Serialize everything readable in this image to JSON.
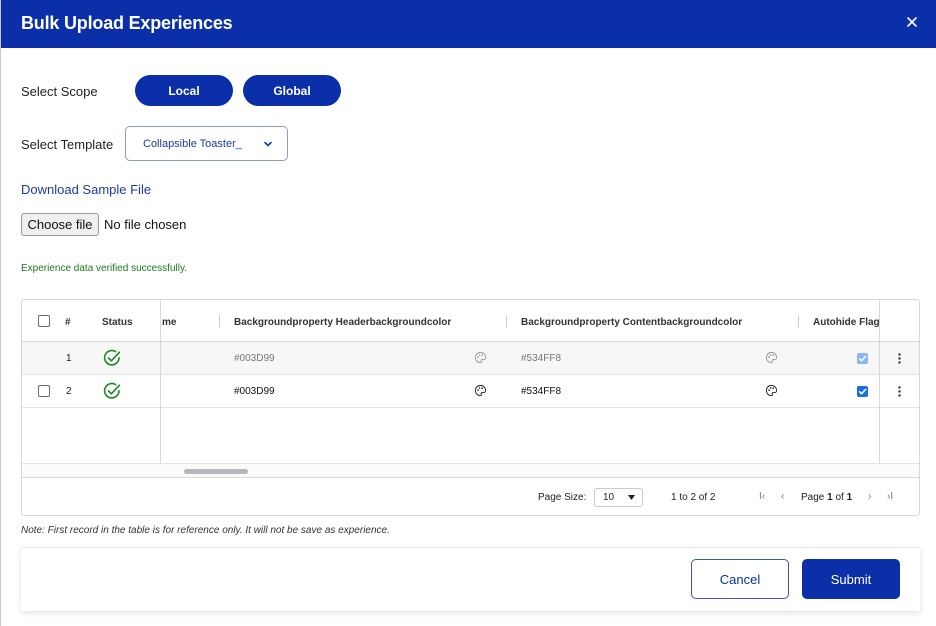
{
  "dialog": {
    "title": "Bulk Upload Experiences"
  },
  "scope": {
    "label": "Select Scope",
    "options": [
      "Local",
      "Global"
    ]
  },
  "template": {
    "label": "Select Template",
    "selected": "Collapsible Toaster_"
  },
  "download_link": "Download Sample File",
  "file_input": {
    "button": "Choose file",
    "status": "No file chosen"
  },
  "verification_message": "Experience data verified successfully.",
  "table": {
    "columns": [
      "#",
      "Status",
      "me",
      "Backgroundproperty Headerbackgroundcolor",
      "Backgroundproperty Contentbackgroundcolor",
      "Autohide Flag"
    ],
    "rows": [
      {
        "num": "1",
        "header_bg": "#003D99",
        "content_bg": "#534FF8",
        "autohide": true,
        "reference": true
      },
      {
        "num": "2",
        "header_bg": "#003D99",
        "content_bg": "#534FF8",
        "autohide": true,
        "reference": false
      }
    ]
  },
  "pagination": {
    "page_size_label": "Page Size:",
    "page_size": "10",
    "range": "1 to 2 of 2",
    "page_prefix": "Page",
    "current_page": "1",
    "page_of": "of",
    "total_pages": "1"
  },
  "note": "Note: First record in the table is for reference only. It will not be save as experience.",
  "actions": {
    "cancel": "Cancel",
    "submit": "Submit"
  },
  "colors": {
    "primary": "#0a2fa8",
    "success": "#1b7a22",
    "checkbox": "#1a6fe0"
  }
}
